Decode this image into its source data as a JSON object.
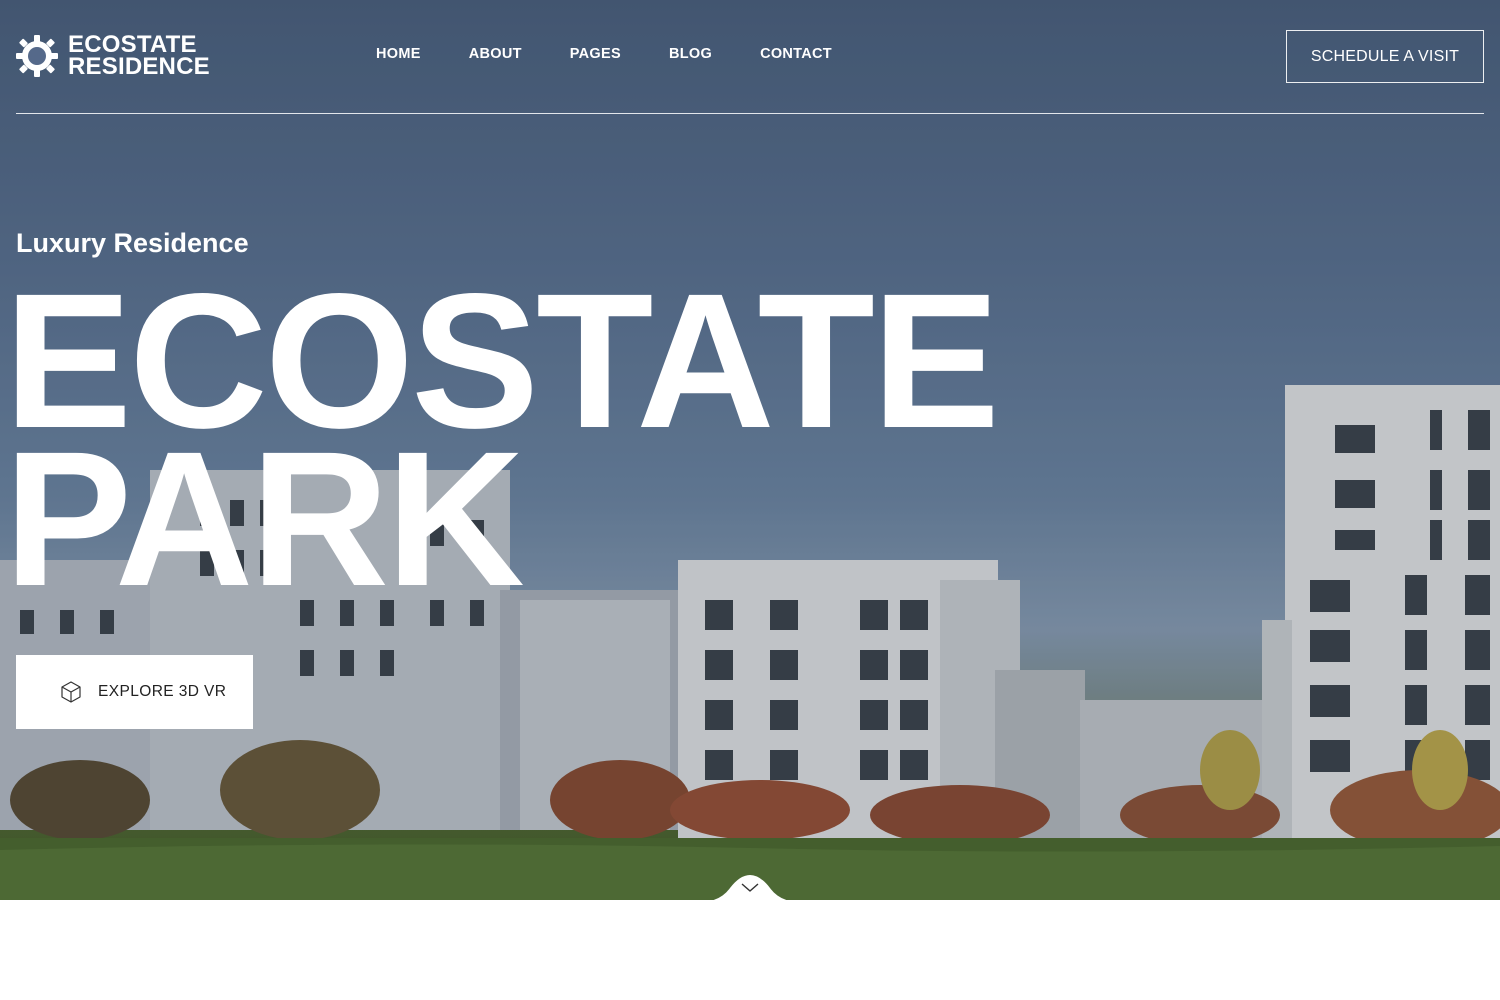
{
  "brand": {
    "line1": "ECOSTATE",
    "line2": "RESIDENCE"
  },
  "nav": {
    "items": [
      {
        "label": "HOME"
      },
      {
        "label": "ABOUT"
      },
      {
        "label": "PAGES"
      },
      {
        "label": "BLOG"
      },
      {
        "label": "CONTACT"
      }
    ]
  },
  "header": {
    "cta_label": "SCHEDULE A VISIT"
  },
  "hero": {
    "subtitle": "Luxury Residence",
    "title_line1": "ECOSTATE",
    "title_line2": "PARK",
    "vr_button_label": "EXPLORE 3D VR",
    "vr_icon": "cube-icon",
    "scroll_icon": "chevron-down-icon"
  },
  "colors": {
    "text": "#ffffff",
    "button_bg": "#ffffff",
    "button_text": "#222222"
  }
}
